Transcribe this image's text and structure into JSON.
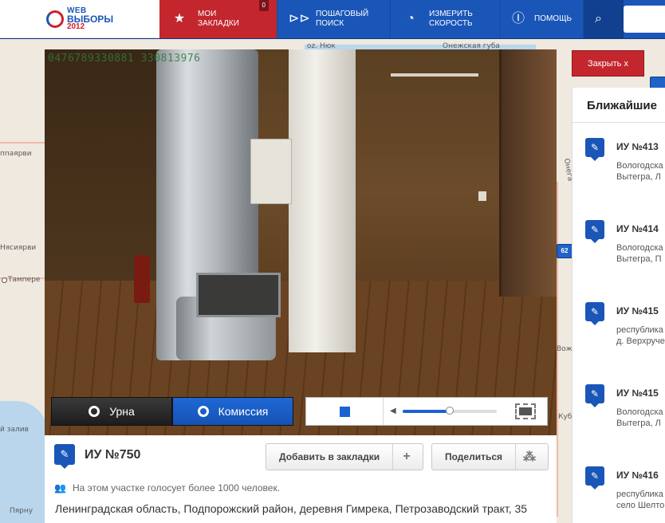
{
  "header": {
    "logo": {
      "line1": "WEB",
      "line2": "ВЫБОРЫ",
      "line3": "2012"
    },
    "nav": [
      {
        "label_line1": "МОИ",
        "label_line2": "ЗАКЛАДКИ",
        "icon": "star-icon",
        "badge": "0"
      },
      {
        "label_line1": "ПОШАГОВЫЙ",
        "label_line2": "ПОИСК",
        "icon": "step-arrows-icon"
      },
      {
        "label_line1": "ИЗМЕРИТЬ",
        "label_line2": "СКОРОСТЬ",
        "icon": "speedometer-icon"
      },
      {
        "label_line1": "ПОМОЩЬ",
        "label_line2": "",
        "icon": "help-icon"
      }
    ],
    "search_icon": "search-icon"
  },
  "map": {
    "labels": [
      "oz. Нюк",
      "Онежская губа",
      "Онега",
      "ппаярви",
      "Нясиярви",
      "Тампере",
      "й залив",
      "Пярну",
      "Вож",
      "Куб"
    ],
    "markers": [
      "62"
    ]
  },
  "video": {
    "timestamp": "0476789330881 330813976",
    "tabs": [
      {
        "label": "Урна",
        "active": false
      },
      {
        "label": "Комиссия",
        "active": true
      }
    ],
    "volume_level": 0.5
  },
  "station": {
    "title": "ИУ №750",
    "bookmark_button": "Добавить в закладки",
    "bookmark_icon": "+",
    "share_button": "Поделиться",
    "votes_text": "На этом участке голосует более 1000 человек.",
    "address": "Ленинградская область, Подпорожский район, деревня Гимрека, Петрозаводский тракт, 35"
  },
  "close_button": "Закрыть  x",
  "nearest": {
    "title": "Ближайшие",
    "items": [
      {
        "name": "ИУ №413",
        "addr_line1": "Вологодска",
        "addr_line2": "Вытегра, Л"
      },
      {
        "name": "ИУ №414",
        "addr_line1": "Вологодска",
        "addr_line2": "Вытегра, П"
      },
      {
        "name": "ИУ №415",
        "addr_line1": "республика",
        "addr_line2": "д. Верхруче"
      },
      {
        "name": "ИУ №415",
        "addr_line1": "Вологодска",
        "addr_line2": "Вытегра, Л"
      },
      {
        "name": "ИУ №416",
        "addr_line1": "республика",
        "addr_line2": "село Шелто"
      }
    ]
  }
}
